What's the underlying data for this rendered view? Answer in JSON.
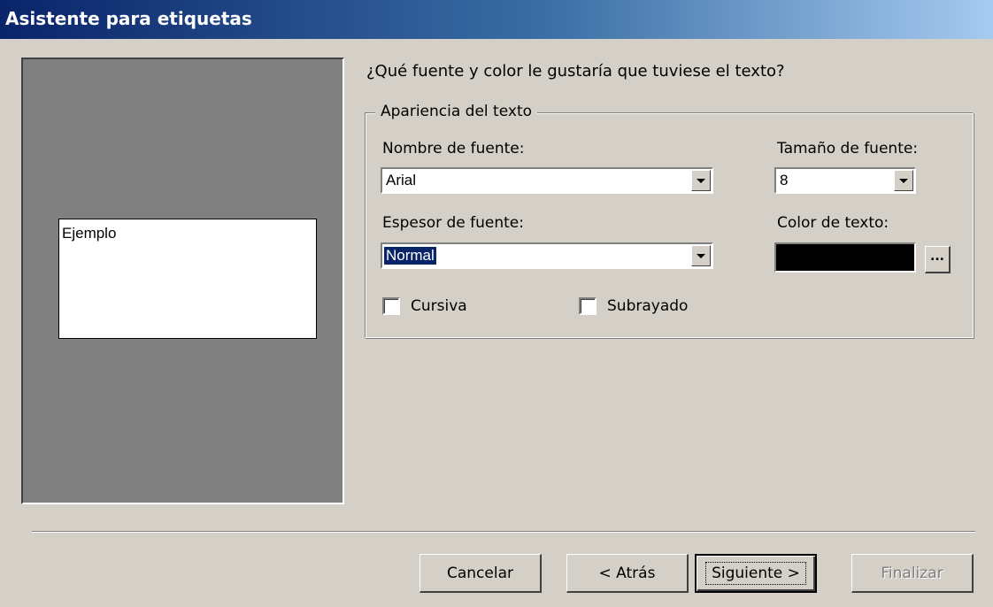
{
  "window": {
    "title": "Asistente para etiquetas"
  },
  "preview": {
    "sample_text": "Ejemplo"
  },
  "main": {
    "question": "¿Qué fuente y color le gustaría que tuviese el texto?",
    "group_title": "Apariencia del texto",
    "font_name": {
      "label": "Nombre de fuente:",
      "value": "Arial"
    },
    "font_size": {
      "label": "Tamaño de fuente:",
      "value": "8"
    },
    "font_weight": {
      "label": "Espesor de fuente:",
      "value": "Normal"
    },
    "text_color": {
      "label": "Color de texto:",
      "value": "#000000",
      "button_label": "..."
    },
    "italic": {
      "label": "Cursiva",
      "checked": false
    },
    "underline": {
      "label": "Subrayado",
      "checked": false
    }
  },
  "footer": {
    "cancel_label": "Cancelar",
    "back_label": "< Atrás",
    "next_label": "Siguiente >",
    "finish_label": "Finalizar"
  },
  "colors": {
    "title_gradient_start": "#0a246a",
    "title_gradient_end": "#a6caf0",
    "dialog_bg": "#d4d0c8",
    "preview_bg": "#808080",
    "selection": "#0a246a"
  }
}
